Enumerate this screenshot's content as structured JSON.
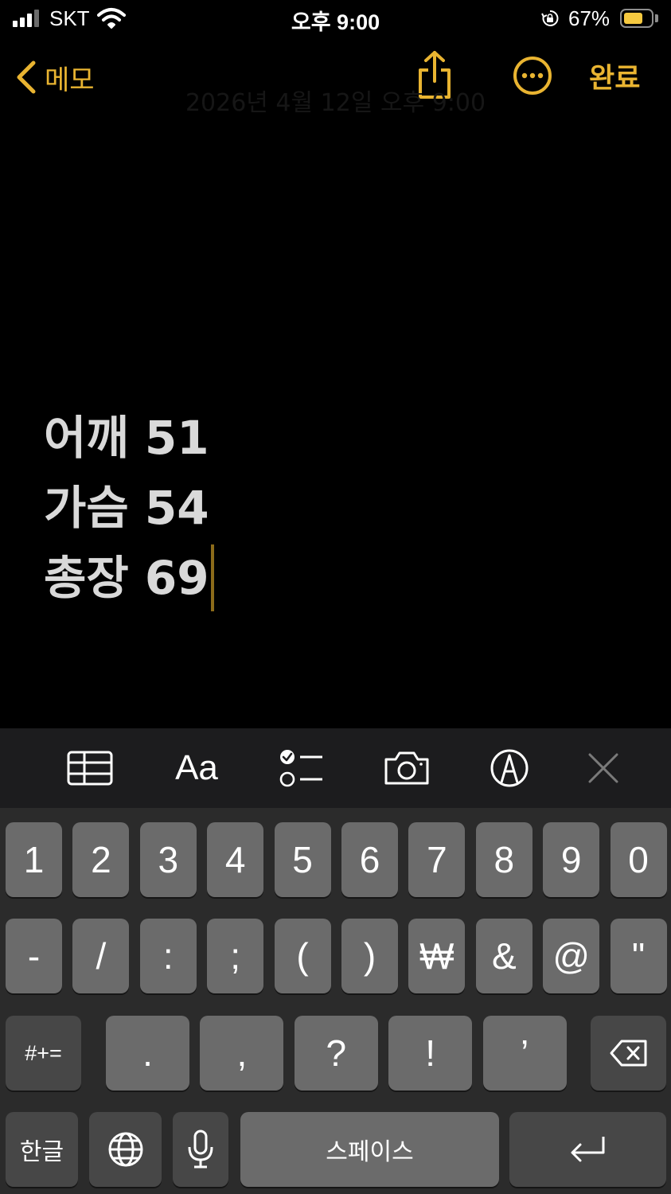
{
  "status_bar": {
    "carrier": "SKT",
    "time": "오후 9:00",
    "battery_percent": "67%",
    "battery_level": 0.67,
    "icons": [
      "signal-icon",
      "wifi-icon",
      "orientation-lock-icon",
      "battery-icon"
    ]
  },
  "nav": {
    "back_label": "메모",
    "done_label": "완료",
    "date_text": "2026년 4월 12일 오후 9:00",
    "icons": [
      "chevron-left-icon",
      "share-icon",
      "more-icon"
    ]
  },
  "note": {
    "lines": [
      "어깨 51",
      "가슴 54",
      "총장 69"
    ]
  },
  "toolbar": {
    "format_label": "Aa",
    "icons": [
      "table-icon",
      "format-icon",
      "checklist-icon",
      "camera-icon",
      "markup-icon",
      "close-icon"
    ]
  },
  "keyboard": {
    "row1": [
      "1",
      "2",
      "3",
      "4",
      "5",
      "6",
      "7",
      "8",
      "9",
      "0"
    ],
    "row2": [
      "-",
      "/",
      ":",
      ";",
      "(",
      ")",
      "₩",
      "&",
      "@",
      "\""
    ],
    "row3": [
      ".",
      ",",
      "?",
      "!",
      "’"
    ],
    "symbols_label": "#+=",
    "lang_label": "한글",
    "space_label": "스페이스",
    "icons": [
      "delete-icon",
      "globe-icon",
      "microphone-icon",
      "return-icon"
    ]
  },
  "colors": {
    "accent": "#e9b431",
    "background": "#000000",
    "toolbar": "#1c1c1e",
    "keyboard": "#2b2b2b",
    "key": "#6b6b6b",
    "key_dark": "#474747"
  }
}
